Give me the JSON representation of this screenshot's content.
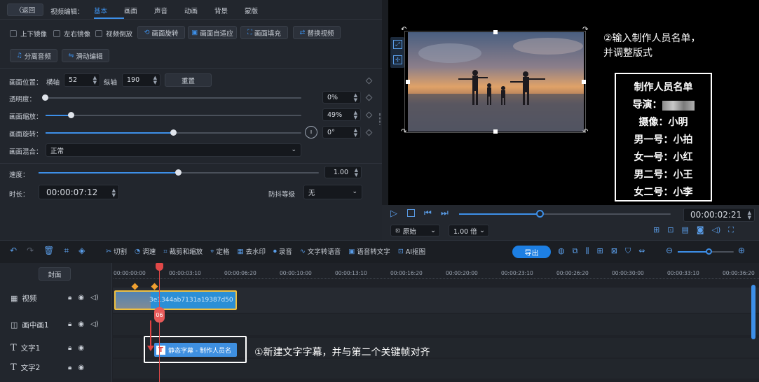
{
  "header": {
    "back_label": "〈返回",
    "section_label": "视频编辑：",
    "tabs": [
      "基本",
      "画面",
      "声音",
      "动画",
      "背景",
      "蒙版"
    ]
  },
  "options": {
    "flip_v": "上下镜像",
    "flip_h": "左右镜像",
    "reverse": "视频倒放",
    "rotate_btn": "画面旋转",
    "adapt_btn": "画面自适应",
    "fill_btn": "画面填充",
    "replace_btn": "替换视频",
    "split_audio_btn": "分离音频",
    "slide_edit_btn": "滑动编辑"
  },
  "properties": {
    "position_label": "画面位置：",
    "x_label": "横轴",
    "x_value": "52",
    "y_label": "纵轴",
    "y_value": "190",
    "reset_label": "重置",
    "opacity_label": "透明度：",
    "opacity_value": "0%",
    "opacity_level": 0,
    "scale_label": "画面缩放：",
    "scale_value": "49%",
    "scale_level": 0.1,
    "rotate_label": "画面旋转：",
    "rotate_value": "0°",
    "rotate_level": 0.5,
    "blend_label": "画面混合：",
    "blend_value": "正常",
    "speed_label": "速度：",
    "speed_value": "1.00",
    "speed_level": 0.5,
    "duration_label": "时长：",
    "duration_value": "00:00:07:12",
    "stabilize_label": "防抖等级",
    "stabilize_value": "无"
  },
  "preview": {
    "annotation_line1": "②输入制作人员名单，",
    "annotation_line2": "并调整版式",
    "credits": {
      "title": "制作人员名单",
      "director_label": "导演：",
      "lines": [
        "摄像：小明",
        "男一号：小拍",
        "女一号：小红",
        "男二号：小王",
        "女二号：小李"
      ]
    },
    "time": "00:00:02:21",
    "progress_level": 0.38,
    "ratio_value": "原始",
    "speed_value": "1.00 倍"
  },
  "toolbar": {
    "items": [
      "切割",
      "调速",
      "裁剪和缩放",
      "定格",
      "去水印",
      "录音",
      "文字转语音",
      "语音转文字",
      "AI抠图"
    ],
    "export_label": "导出"
  },
  "timeline": {
    "cover_label": "封面",
    "ticks": [
      "00:00:00:00",
      "00:00:03:10",
      "00:00:06:20",
      "00:00:10:00",
      "00:00:13:10",
      "00:00:16:20",
      "00:00:20:00",
      "00:00:23:10",
      "00:00:26:20",
      "00:00:30:00",
      "00:00:33:10",
      "00:00:36:20"
    ],
    "tracks": [
      "视频",
      "画中画1",
      "文字1",
      "文字2"
    ],
    "video_clip_label": "3e1344ab7131a19387d50",
    "playhead_marker": "06",
    "text_clip_label": "静态字幕 - 制作人员名",
    "annotation": "①新建文字字幕，并与第二个关键帧对齐"
  }
}
